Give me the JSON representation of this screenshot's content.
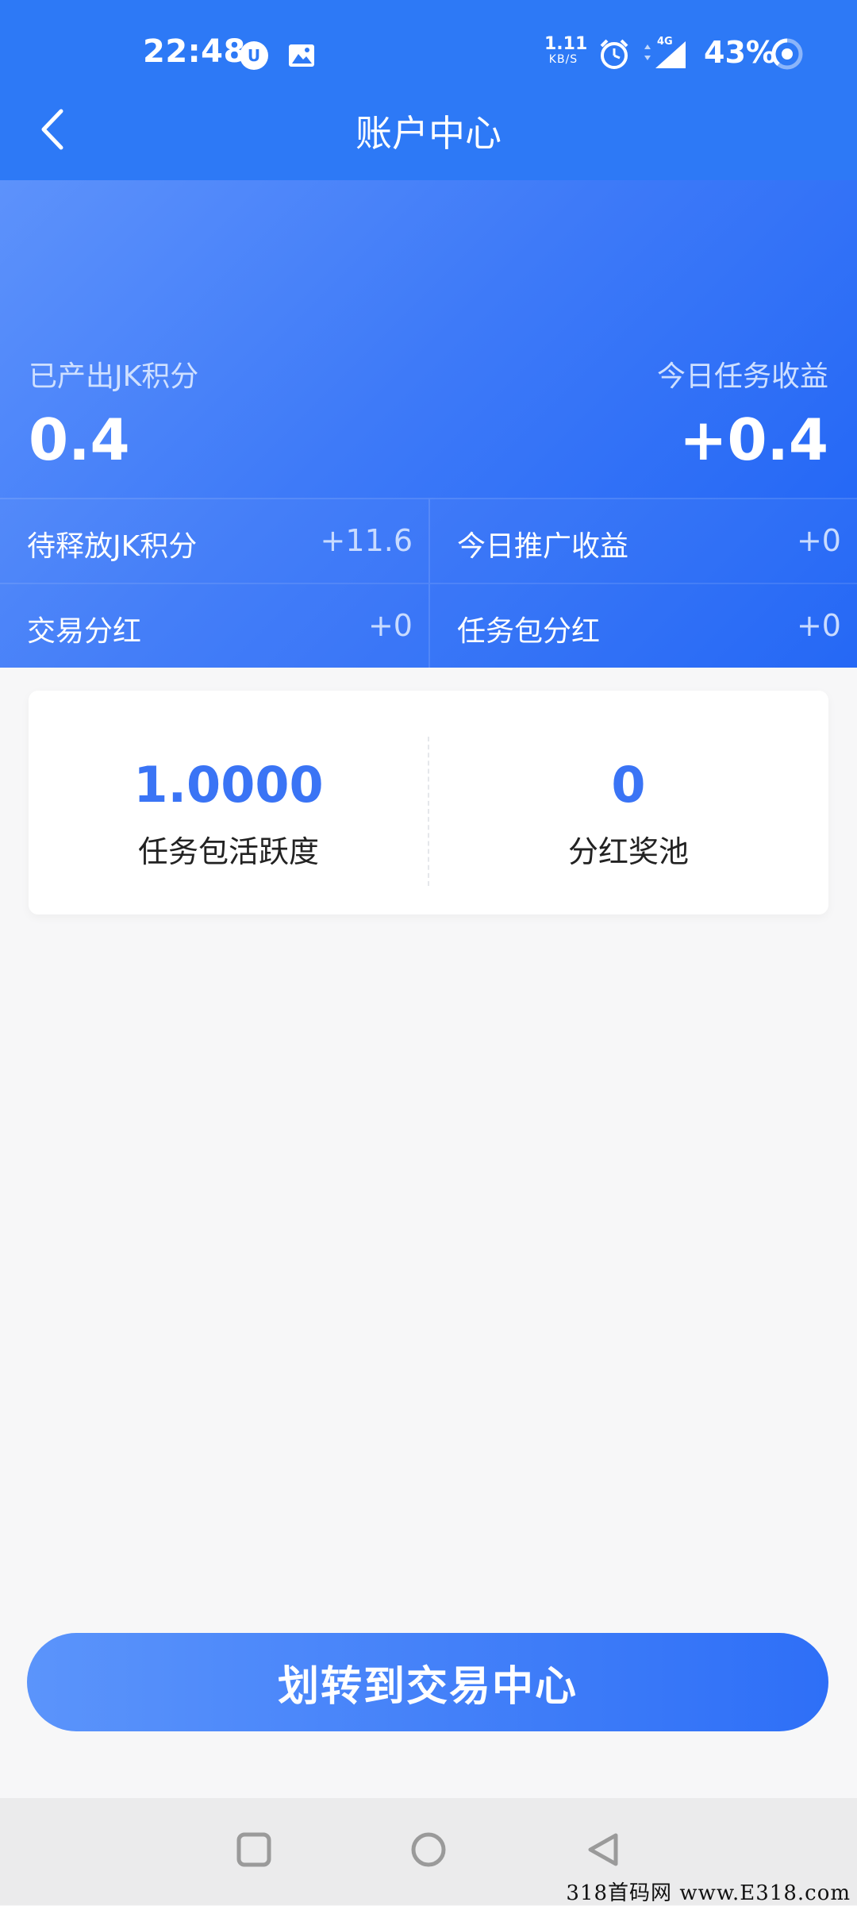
{
  "status_bar": {
    "time": "22:48",
    "net_speed_value": "1.11",
    "net_speed_unit": "KB/S",
    "network_type": "4G",
    "battery_percent": "43%"
  },
  "header": {
    "title": "账户中心"
  },
  "summary": {
    "produced_label": "已产出JK积分",
    "produced_value": "0.4",
    "today_task_label": "今日任务收益",
    "today_task_value": "+0.4",
    "cells": [
      {
        "label": "待释放JK积分",
        "value": "+11.6"
      },
      {
        "label": "今日推广收益",
        "value": "+0"
      },
      {
        "label": "交易分红",
        "value": "+0"
      },
      {
        "label": "任务包分红",
        "value": "+0"
      }
    ]
  },
  "stats_card": {
    "activity_value": "1.0000",
    "activity_label": "任务包活跃度",
    "pool_value": "0",
    "pool_label": "分红奖池"
  },
  "actions": {
    "transfer_label": "划转到交易中心"
  },
  "watermark": "318首码网 www.E318.com",
  "colors": {
    "primary": "#2d79f6",
    "accent_value": "#3a74f5",
    "background": "#f7f7f8"
  }
}
